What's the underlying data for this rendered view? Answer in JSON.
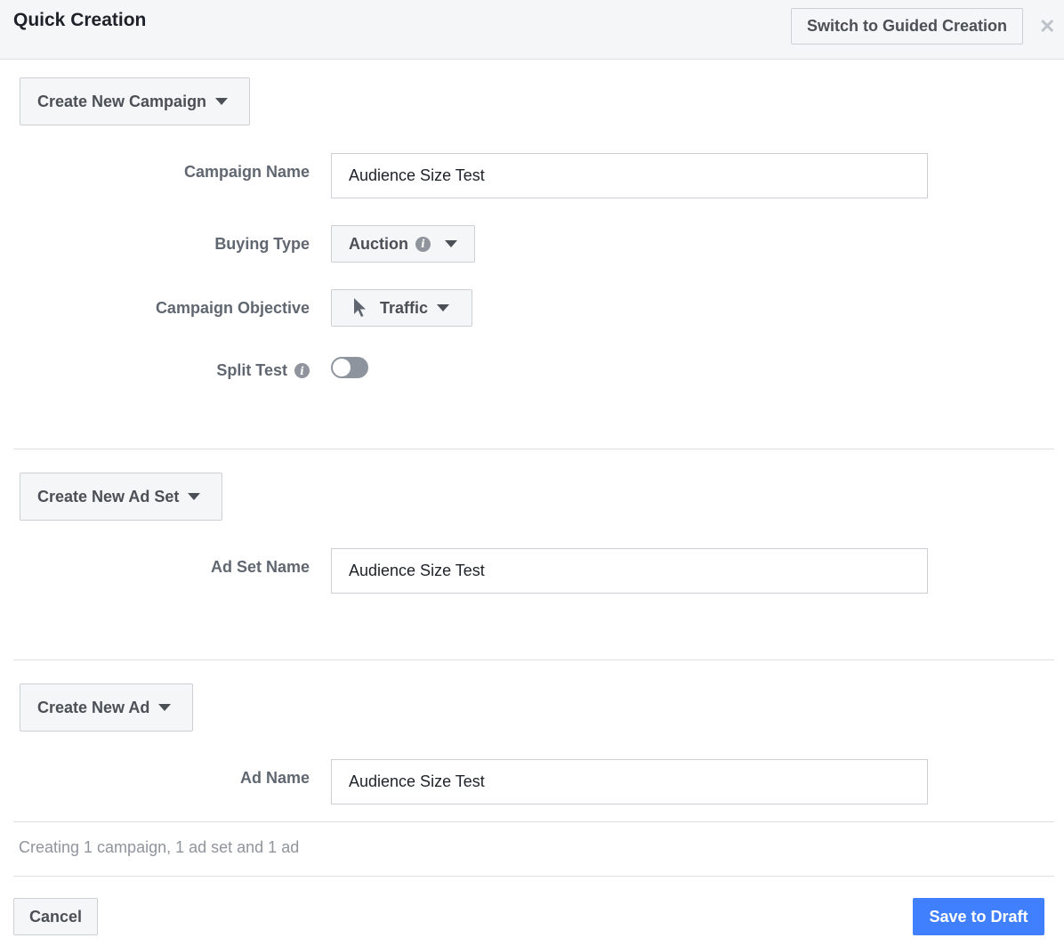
{
  "header": {
    "title": "Quick Creation",
    "switch_label": "Switch to Guided Creation",
    "close_glyph": "✕"
  },
  "campaign": {
    "section_button": "Create New Campaign",
    "name_label": "Campaign Name",
    "name_value": "Audience Size Test",
    "buying_type_label": "Buying Type",
    "buying_type_value": "Auction",
    "objective_label": "Campaign Objective",
    "objective_value": "Traffic",
    "split_test_label": "Split Test",
    "split_test_on": false
  },
  "ad_set": {
    "section_button": "Create New Ad Set",
    "name_label": "Ad Set Name",
    "name_value": "Audience Size Test"
  },
  "ad": {
    "section_button": "Create New Ad",
    "name_label": "Ad Name",
    "name_value": "Audience Size Test"
  },
  "footer": {
    "status_text": "Creating 1 campaign, 1 ad set and 1 ad",
    "cancel_label": "Cancel",
    "save_label": "Save to Draft"
  },
  "colors": {
    "primary_button": "#4080ff",
    "toggle_off": "#8d949e",
    "header_bg": "#f5f6f7"
  },
  "icons": {
    "info": "info-icon",
    "caret": "caret-down-icon",
    "objective": "cursor-arrow-icon",
    "close": "close-icon"
  }
}
